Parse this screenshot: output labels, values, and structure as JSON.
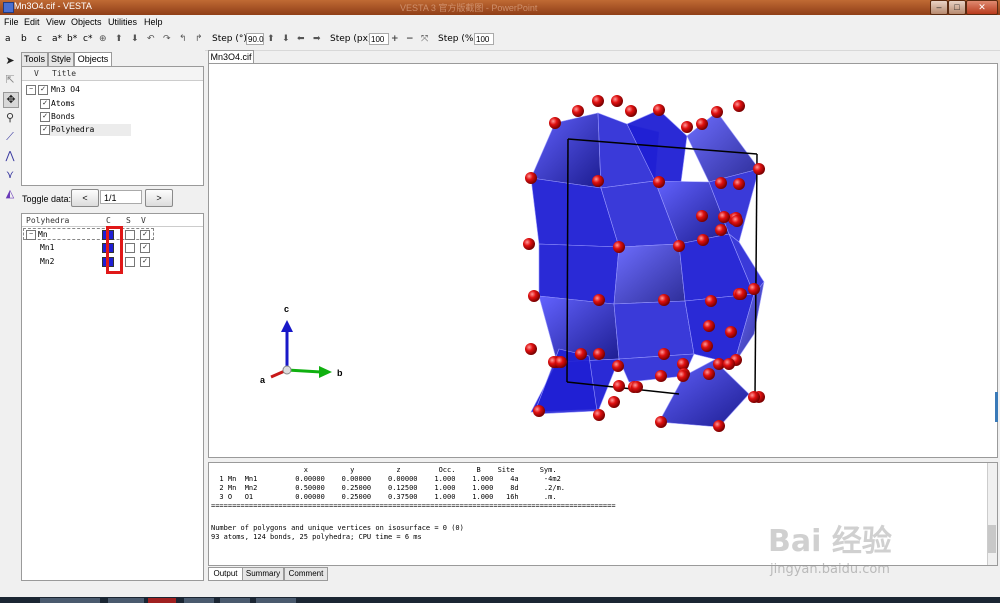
{
  "window": {
    "title": "Mn3O4.cif - VESTA",
    "ghost_title": "VESTA 3 官方版截图 - PowerPoint",
    "minimize": "–",
    "maximize": "□",
    "close": "✕"
  },
  "menubar": [
    "File",
    "Edit",
    "View",
    "Objects",
    "Utilities",
    "Help"
  ],
  "toolbar": {
    "axis_buttons": [
      "a",
      "b",
      "c",
      "a*",
      "b*",
      "c*"
    ],
    "step_deg_label": "Step (°):",
    "step_deg_value": "90.0",
    "step_px_label": "Step (px):",
    "step_px_value": "100",
    "step_pct_label": "Step (%):",
    "step_pct_value": "100"
  },
  "left_tools": [
    "select-icon",
    "select-multi-icon",
    "translate-icon",
    "magnify-icon",
    "bond-length-icon",
    "bond-angle-icon",
    "dihedral-icon",
    "plane-icon"
  ],
  "panel_tabs": [
    "Tools",
    "Style",
    "Objects"
  ],
  "objects_tree": {
    "header_v": "V",
    "header_title": "Title",
    "root": "Mn3 O4",
    "children": [
      "Atoms",
      "Bonds",
      "Polyhedra"
    ]
  },
  "toggle": {
    "label": "Toggle data:",
    "prev": "<",
    "value": "1/1",
    "next": ">"
  },
  "polyhedra_table": {
    "headers": [
      "Polyhedra",
      "C",
      "S",
      "V"
    ],
    "rows": [
      {
        "name": "Mn",
        "indent": 0
      },
      {
        "name": "Mn1",
        "indent": 1
      },
      {
        "name": "Mn2",
        "indent": 1
      }
    ]
  },
  "viewer_tab": "Mn3O4.cif",
  "axes": {
    "c": "c",
    "b": "b",
    "a": "a"
  },
  "output": {
    "table_header": "                      x          y          z         Occ.     B    Site      Sym.",
    "rows": [
      "  1 Mn  Mn1         0.00000    0.00000    0.00000    1.000    1.000    4a      -4m2",
      "  2 Mn  Mn2         0.50000    0.25000    0.12500    1.000    1.000    8d      .2/m.",
      "  3 O   O1          0.00000    0.25000    0.37500    1.000    1.000   16h      .m."
    ],
    "separator": "================================================================================================",
    "line1": "Number of polygons and unique vertices on isosurface = 0 (0)",
    "line2": "93 atoms, 124 bonds, 25 polyhedra; CPU time = 6 ms"
  },
  "output_tabs": [
    "Output",
    "Summary",
    "Comment"
  ],
  "watermark": {
    "main": "Bai 经验",
    "sub": "jingyan.baidu.com"
  },
  "colors": {
    "polyhedra": "#1f1fd4",
    "oxygen": "#e01010",
    "title_bar": "#a4522a",
    "highlight_box": "#e01818"
  }
}
